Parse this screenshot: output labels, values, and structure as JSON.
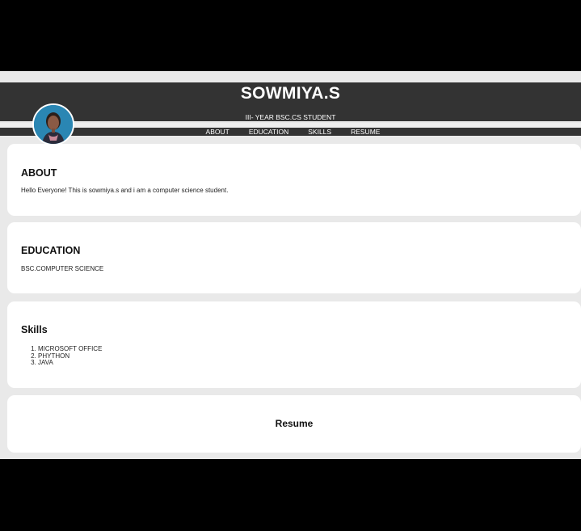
{
  "header": {
    "name": "SOWMIYA.S",
    "subtitle": "III- YEAR BSC.CS STUDENT"
  },
  "nav": {
    "items": [
      "ABOUT",
      "EDUCATION",
      "SKILLS",
      "RESUME"
    ]
  },
  "about": {
    "heading": "ABOUT",
    "text": "Hello Everyone! This is sowmiya.s and i am a computer science student."
  },
  "education": {
    "heading": "EDUCATION",
    "text": "BSC.COMPUTER SCIENCE"
  },
  "skills": {
    "heading": "Skills",
    "items": [
      "MICROSOFT OFFICE",
      "PHYTHON",
      "JAVA"
    ]
  },
  "resume": {
    "heading": "Resume"
  },
  "colors": {
    "header_bg": "#333333",
    "page_bg": "#e9e9e9",
    "card_bg": "#ffffff",
    "outer_bg": "#000000"
  }
}
